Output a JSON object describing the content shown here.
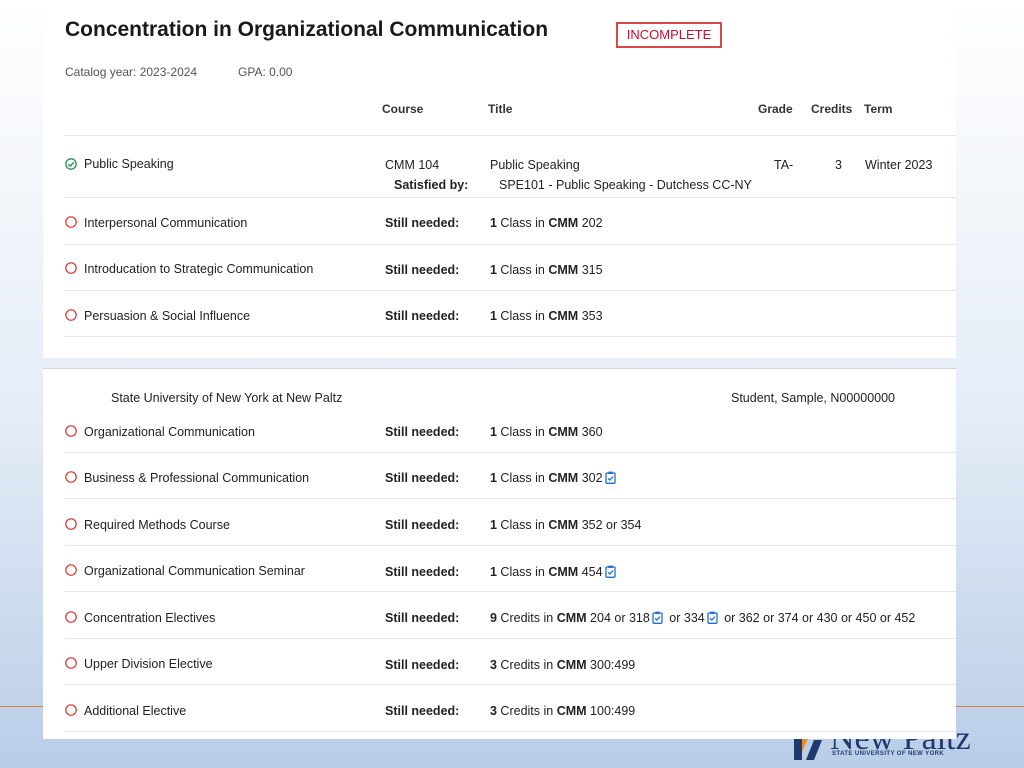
{
  "header": {
    "title": "Concentration in Organizational Communication",
    "status_badge": "INCOMPLETE",
    "catalog_year": "Catalog year:  2023-2024",
    "gpa": "GPA: 0.00"
  },
  "columns": {
    "course": "Course",
    "title": "Title",
    "grade": "Grade",
    "credits": "Credits",
    "term": "Term"
  },
  "satisfied_row": {
    "name": "Public Speaking",
    "course": "CMM 104",
    "title": "Public Speaking",
    "grade": "TA-",
    "credits": "3",
    "term": "Winter 2023",
    "satisfied_label": "Satisfied by:",
    "satisfied_value": "SPE101 - Public Speaking - Dutchess CC-NY"
  },
  "still_needed_label": "Still needed:",
  "requirements_top": [
    {
      "name": "Interpersonal Communication",
      "count": "1",
      "text": " Class in ",
      "subject": "CMM",
      "rest": " 202"
    },
    {
      "name": "Introducation to Strategic Communication",
      "count": "1",
      "text": " Class in ",
      "subject": "CMM",
      "rest": " 315"
    },
    {
      "name": "Persuasion & Social Influence",
      "count": "1",
      "text": " Class in ",
      "subject": "CMM",
      "rest": " 353"
    }
  ],
  "footer": {
    "university": "State University of New York at New Paltz",
    "student": "Student, Sample, N00000000"
  },
  "requirements_bottom": [
    {
      "name": "Organizational Communication",
      "count": "1",
      "text": " Class in ",
      "subject": "CMM",
      "rest": " 360"
    },
    {
      "name": "Business & Professional Communication",
      "count": "1",
      "text": " Class in ",
      "subject": "CMM",
      "rest": " 302"
    },
    {
      "name": "Required Methods Course",
      "count": "1",
      "text": " Class in ",
      "subject": "CMM",
      "rest": " 352 or 354"
    },
    {
      "name": "Organizational Communication Seminar",
      "count": "1",
      "text": " Class in ",
      "subject": "CMM",
      "rest": " 454"
    },
    {
      "name": "Concentration Electives",
      "count": "9",
      "text": " Credits in ",
      "subject": "CMM",
      "rest_a": " 204 or 318",
      "rest_b": " or 334",
      "rest_c": " or 362 or 374 or 430 or 450 or 452"
    },
    {
      "name": "Upper Division Elective",
      "count": "3",
      "text": " Credits in ",
      "subject": "CMM",
      "rest": " 300:499"
    },
    {
      "name": "Additional Elective",
      "count": "3",
      "text": " Credits in ",
      "subject": "CMM",
      "rest": " 100:499"
    }
  ],
  "logo": {
    "name": "New Paltz",
    "subtitle": "STATE UNIVERSITY OF NEW YORK"
  },
  "colors": {
    "incomplete": "#c8102e",
    "complete": "#2e8b57",
    "needed": "#d9342b",
    "info_icon": "#1f6fd1",
    "accent_line": "#e07a3a"
  }
}
